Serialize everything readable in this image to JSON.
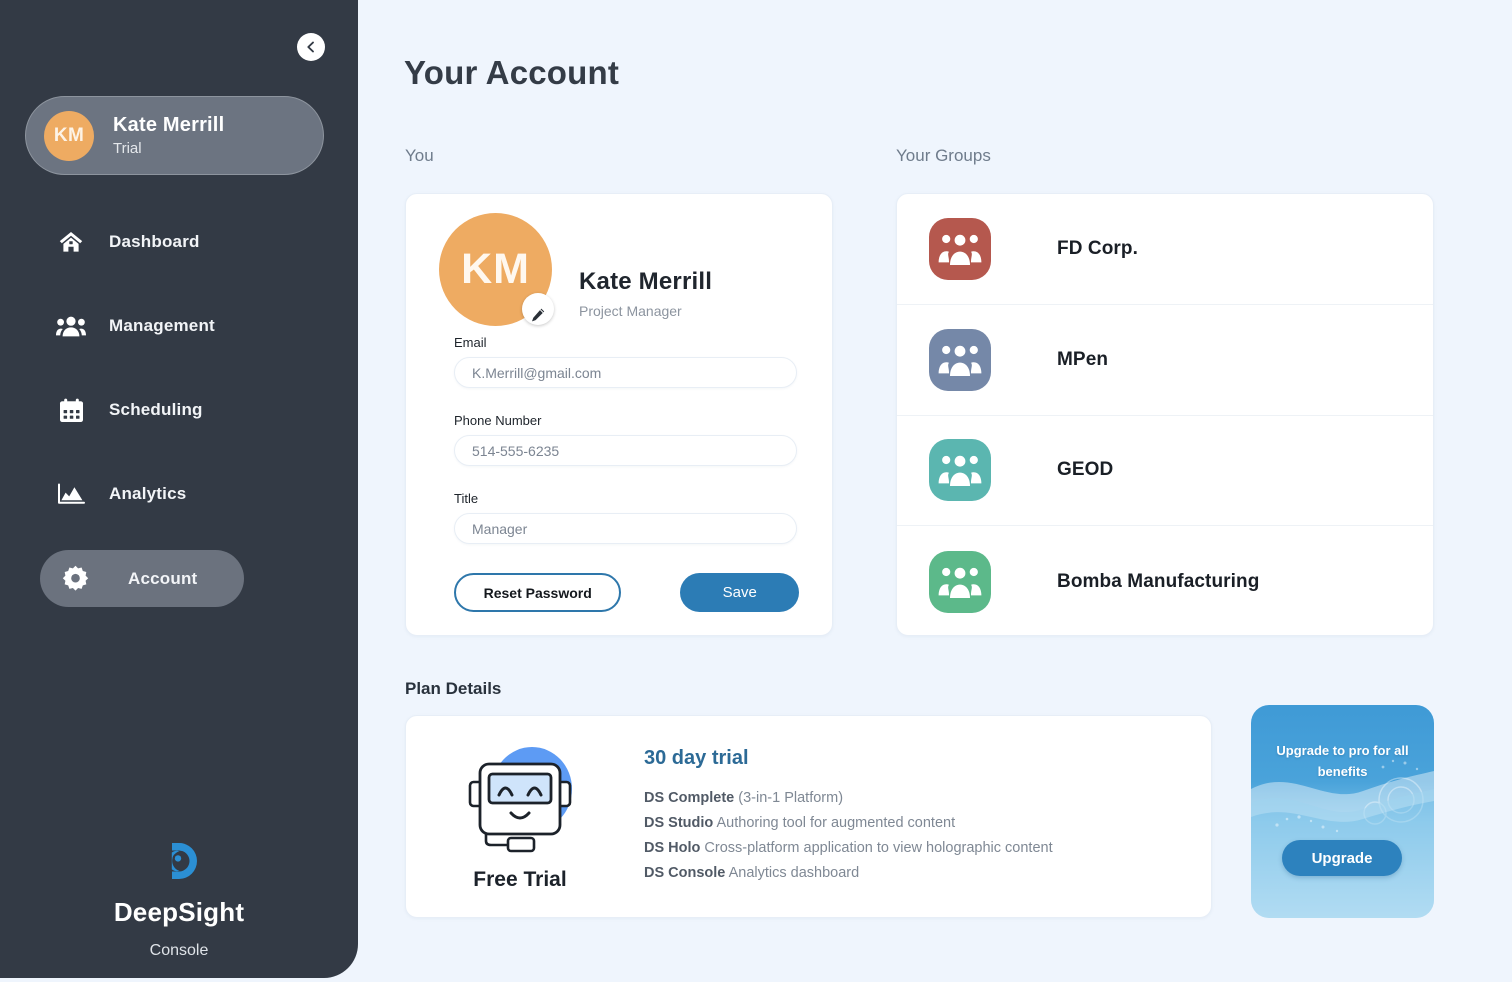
{
  "sidebar": {
    "collapse_icon": "chevron-left-icon",
    "user": {
      "initials": "KM",
      "name": "Kate Merrill",
      "plan": "Trial"
    },
    "nav": [
      {
        "label": "Dashboard",
        "icon": "home-icon",
        "active": false
      },
      {
        "label": "Management",
        "icon": "users-icon",
        "active": false
      },
      {
        "label": "Scheduling",
        "icon": "calendar-icon",
        "active": false
      },
      {
        "label": "Analytics",
        "icon": "chart-area-icon",
        "active": false
      },
      {
        "label": "Account",
        "icon": "gear-icon",
        "active": true
      }
    ],
    "brand": {
      "mark_icon": "deepsight-eye-logo",
      "name": "DeepSight",
      "subtitle": "Console",
      "color": "#2b8fd4"
    }
  },
  "main": {
    "page_title": "Your Account",
    "you_label": "You",
    "groups_label": "Your Groups",
    "plan_label": "Plan Details"
  },
  "account": {
    "avatar_initials": "KM",
    "avatar_color": "#eeab62",
    "edit_icon": "pencil-icon",
    "name": "Kate Merrill",
    "role": "Project Manager",
    "fields": [
      {
        "label": "Email",
        "value": "K.Merrill@gmail.com",
        "placeholder": "K.Merrill@gmail.com"
      },
      {
        "label": "Phone Number",
        "value": "514-555-6235",
        "placeholder": "514-555-6235"
      },
      {
        "label": "Title",
        "value": "Manager",
        "placeholder": "Manager"
      }
    ],
    "reset_label": "Reset Password",
    "save_label": "Save",
    "accent_color": "#2c7cb5"
  },
  "groups": [
    {
      "name": "FD Corp.",
      "icon": "group-people-icon",
      "color": "#b5584e"
    },
    {
      "name": "MPen",
      "icon": "group-people-icon",
      "color": "#7588a8"
    },
    {
      "name": "GEOD",
      "icon": "group-people-icon",
      "color": "#5bb6b0"
    },
    {
      "name": "Bomba Manufacturing",
      "icon": "group-people-icon",
      "color": "#5cb98a"
    }
  ],
  "plan": {
    "mascot_icon": "robot-mascot-icon",
    "mascot_label": "Free Trial",
    "title": "30 day trial",
    "features": [
      {
        "name": "DS Complete",
        "desc": "(3-in-1 Platform)"
      },
      {
        "name": "DS Studio",
        "desc": "Authoring tool for augmented content"
      },
      {
        "name": "DS Holo",
        "desc": "Cross-platform application to view holographic content"
      },
      {
        "name": "DS Console",
        "desc": "Analytics dashboard"
      }
    ]
  },
  "upgrade": {
    "headline": "Upgrade to pro for all benefits",
    "button_label": "Upgrade",
    "button_color": "#2d82be"
  }
}
